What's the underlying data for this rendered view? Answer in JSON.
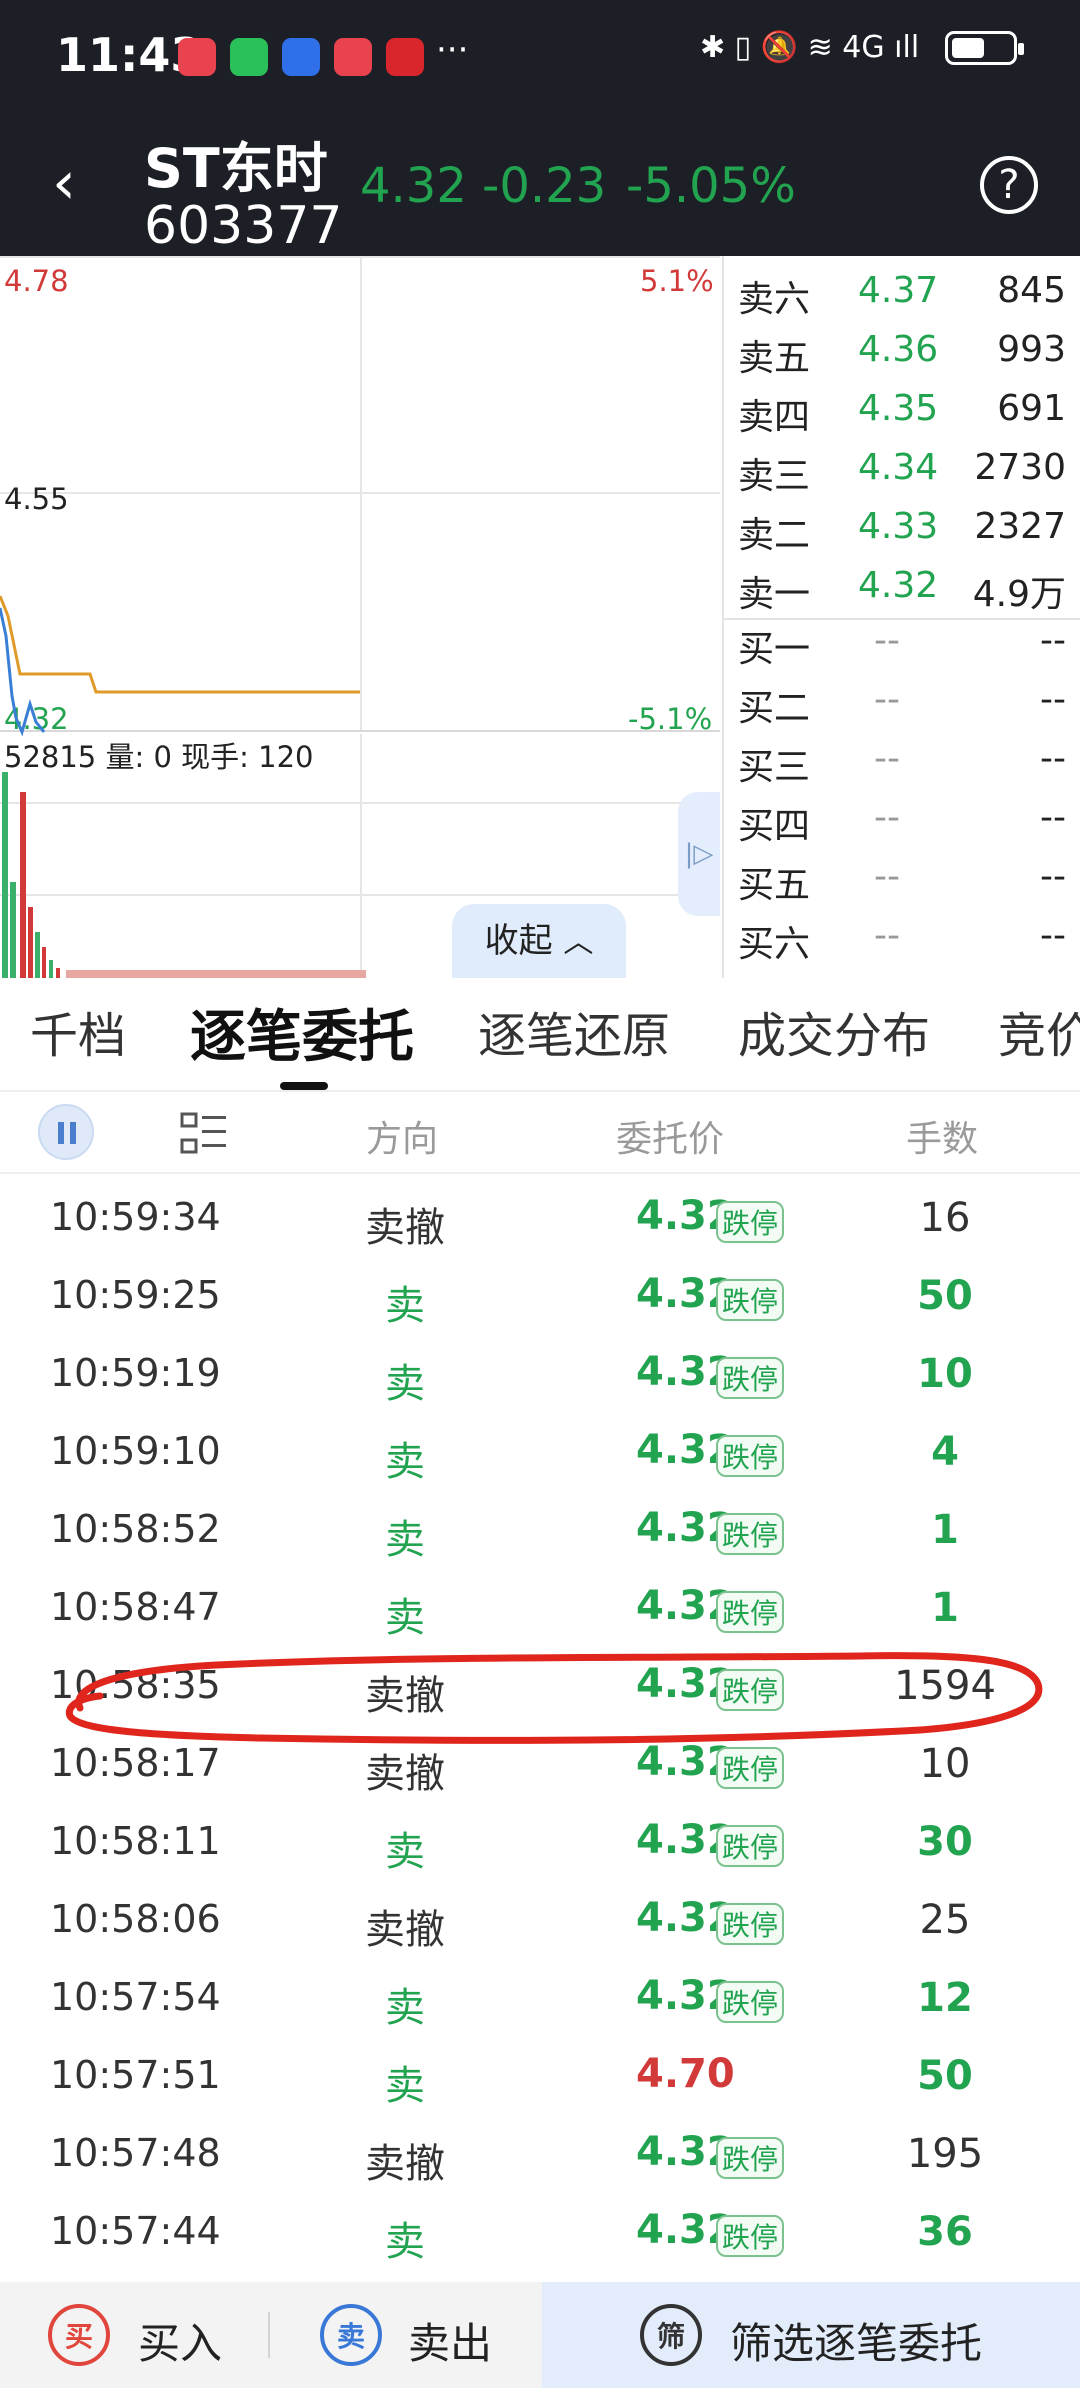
{
  "status_bar": {
    "time": "11:43",
    "more": "···",
    "right_icons": "✱ ▯ 🔕 ≋ 4G ıll"
  },
  "header": {
    "back_icon": "‹",
    "name": "ST东时",
    "code": "603377",
    "price": "4.32",
    "change": "-0.23",
    "change_pct": "-5.05%",
    "help_icon": "?"
  },
  "chart": {
    "top_left": "4.78",
    "top_right": "5.1%",
    "mid_left": "4.55",
    "bottom_left": "4.32",
    "bottom_right": "-5.1%",
    "volume_info": "52815 量: 0 现手: 120",
    "collapse_label": "收起",
    "collapse_icon": "︿",
    "side_icon": "|▷"
  },
  "order_book": {
    "asks": [
      {
        "label": "卖六",
        "price": "4.37",
        "vol": "845"
      },
      {
        "label": "卖五",
        "price": "4.36",
        "vol": "993"
      },
      {
        "label": "卖四",
        "price": "4.35",
        "vol": "691"
      },
      {
        "label": "卖三",
        "price": "4.34",
        "vol": "2730"
      },
      {
        "label": "卖二",
        "price": "4.33",
        "vol": "2327"
      },
      {
        "label": "卖一",
        "price": "4.32",
        "vol": "4.9万"
      }
    ],
    "bids": [
      {
        "label": "买一",
        "price": "--",
        "vol": "--"
      },
      {
        "label": "买二",
        "price": "--",
        "vol": "--"
      },
      {
        "label": "买三",
        "price": "--",
        "vol": "--"
      },
      {
        "label": "买四",
        "price": "--",
        "vol": "--"
      },
      {
        "label": "买五",
        "price": "--",
        "vol": "--"
      },
      {
        "label": "买六",
        "price": "--",
        "vol": "--"
      }
    ]
  },
  "tabs": [
    "千档",
    "逐笔委托",
    "逐笔还原",
    "成交分布",
    "竞价"
  ],
  "table": {
    "headers": {
      "direction": "方向",
      "price": "委托价",
      "qty": "手数"
    },
    "limit_tag": "跌停",
    "rows": [
      {
        "time": "10:59:34",
        "dir": "卖撤",
        "price": "4.32",
        "qty": "16"
      },
      {
        "time": "10:59:25",
        "dir": "卖",
        "price": "4.32",
        "qty": "50"
      },
      {
        "time": "10:59:19",
        "dir": "卖",
        "price": "4.32",
        "qty": "10"
      },
      {
        "time": "10:59:10",
        "dir": "卖",
        "price": "4.32",
        "qty": "4"
      },
      {
        "time": "10:58:52",
        "dir": "卖",
        "price": "4.32",
        "qty": "1"
      },
      {
        "time": "10:58:47",
        "dir": "卖",
        "price": "4.32",
        "qty": "1"
      },
      {
        "time": "10:58:35",
        "dir": "卖撤",
        "price": "4.32",
        "qty": "1594"
      },
      {
        "time": "10:58:17",
        "dir": "卖撤",
        "price": "4.32",
        "qty": "10"
      },
      {
        "time": "10:58:11",
        "dir": "卖",
        "price": "4.32",
        "qty": "30"
      },
      {
        "time": "10:58:06",
        "dir": "卖撤",
        "price": "4.32",
        "qty": "25"
      },
      {
        "time": "10:57:54",
        "dir": "卖",
        "price": "4.32",
        "qty": "12"
      },
      {
        "time": "10:57:51",
        "dir": "卖",
        "price": "4.70",
        "qty": "50"
      },
      {
        "time": "10:57:48",
        "dir": "卖撤",
        "price": "4.32",
        "qty": "195"
      },
      {
        "time": "10:57:44",
        "dir": "卖",
        "price": "4.32",
        "qty": "36"
      }
    ]
  },
  "bottom_bar": {
    "buy_icon": "买",
    "buy_label": "买入",
    "sell_icon": "卖",
    "sell_label": "卖出",
    "filter_icon": "筛",
    "filter_label": "筛选逐笔委托"
  },
  "colors": {
    "up": "#d23a3a",
    "down": "#22a350",
    "header_bg": "#1c1f26",
    "highlight": "#e0261c"
  }
}
